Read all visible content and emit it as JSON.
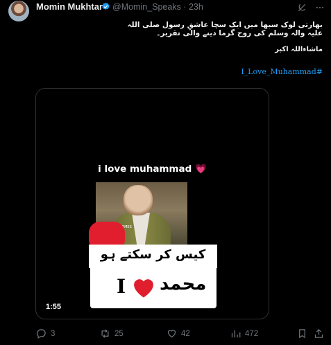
{
  "author": {
    "display_name": "Momin Mukhtar",
    "handle_time": "@Momin_Speaks · 23h"
  },
  "tweet": {
    "text_line1": "بھارتی لوک سبھا میں ایک سچا عاشقِ رسول صلی اللہ علیہ والہ وسلم کی روح گرما دینے والی تقریر۔",
    "text_line2": "ماشاءاللہ اکبر",
    "hashtag": "I_Love_Muhammad#"
  },
  "media": {
    "caption": "i love muhammad 💗",
    "overlay_text": "کیس کر سکتے ہو",
    "watermark": "@SAHAANIMEMES",
    "logo_letter": "I",
    "logo_urdu": "محمد",
    "duration": "1:55"
  },
  "actions": {
    "replies": "3",
    "reposts": "25",
    "likes": "42",
    "views": "472"
  },
  "icons": {
    "verified": "verified-badge-icon",
    "grok": "grok-icon",
    "more": "more-icon",
    "reply": "reply-icon",
    "repost": "repost-icon",
    "like": "heart-icon",
    "views": "views-icon",
    "bookmark": "bookmark-icon",
    "share": "share-icon"
  },
  "colors": {
    "accent": "#1d9bf0",
    "muted": "#71767b",
    "text": "#e7e9ea",
    "heart": "#e01e2d"
  }
}
